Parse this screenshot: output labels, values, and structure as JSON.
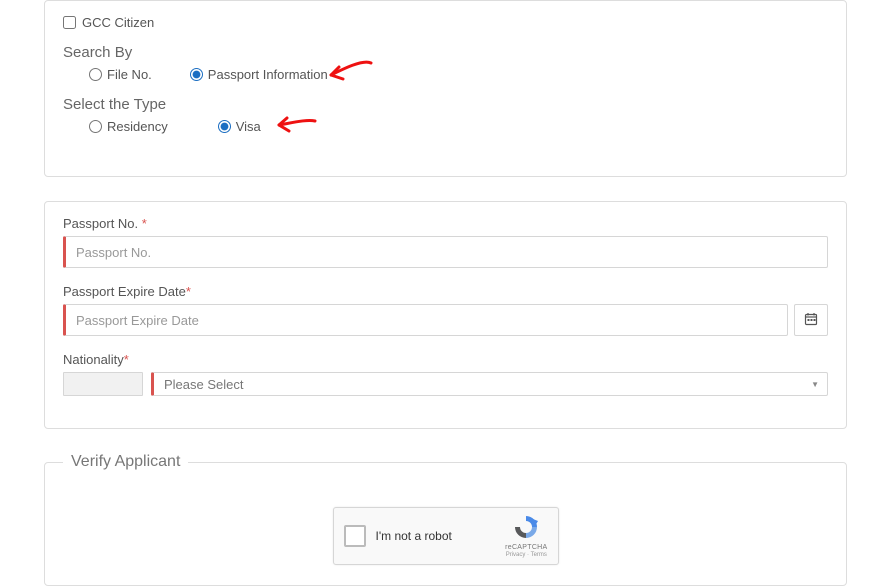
{
  "panel1": {
    "gcc_label": "GCC Citizen",
    "search_by_header": "Search By",
    "file_no_label": "File No.",
    "passport_info_label": "Passport Information",
    "select_type_header": "Select the Type",
    "residency_label": "Residency",
    "visa_label": "Visa"
  },
  "panel2": {
    "passport_no_label": "Passport No.",
    "passport_no_placeholder": "Passport No.",
    "expire_label": "Passport Expire Date",
    "expire_placeholder": "Passport Expire Date",
    "nationality_label": "Nationality",
    "nationality_selected": "Please Select"
  },
  "verify": {
    "legend": "Verify Applicant",
    "rc_text": "I'm not a robot",
    "rc_brand": "reCAPTCHA",
    "rc_terms": "Privacy · Terms"
  },
  "req_mark": "*"
}
